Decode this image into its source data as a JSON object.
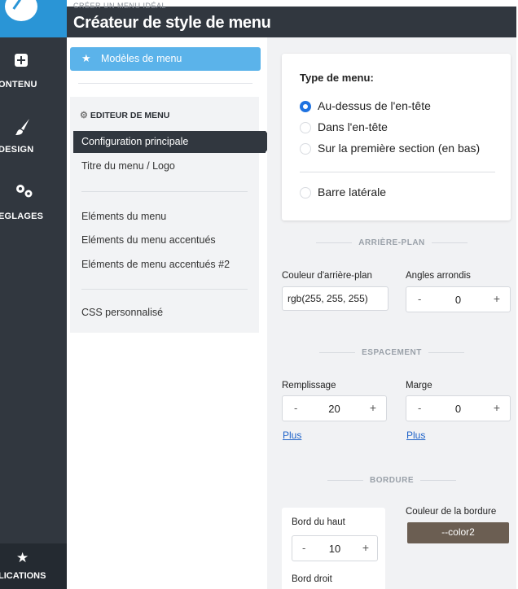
{
  "app": {
    "kicker": "CRÉER UN MENU IDÉAL",
    "title": "Créateur de style de menu"
  },
  "rail": {
    "items": [
      {
        "label": "ONTENU",
        "icon": "plus-square-icon"
      },
      {
        "label": "DESIGN",
        "icon": "brush-icon"
      },
      {
        "label": "EGLAGES",
        "icon": "gears-icon"
      },
      {
        "label": "LICATIONS",
        "icon": "star-icon"
      }
    ]
  },
  "middle": {
    "templates_button": "Modèles de menu",
    "editor_heading": "EDITEUR DE MENU",
    "items": [
      "Configuration principale",
      "Titre du menu / Logo",
      "Eléments du menu",
      "Eléments du menu accentués",
      "Eléments de menu accentués #2",
      "CSS personnalisé"
    ]
  },
  "type_card": {
    "heading": "Type de menu:",
    "options": [
      {
        "label": "Au-dessus de l'en-tête",
        "selected": true
      },
      {
        "label": "Dans l'en-tête",
        "selected": false
      },
      {
        "label": "Sur la première section (en bas)",
        "selected": false
      },
      {
        "label": "Barre latérale",
        "selected": false
      }
    ]
  },
  "background": {
    "section_label": "ARRIÈRE-PLAN",
    "color_label": "Couleur d'arrière-plan",
    "color_value": "rgb(255, 255, 255)",
    "radius_label": "Angles arrondis",
    "radius_value": "0"
  },
  "spacing": {
    "section_label": "ESPACEMENT",
    "padding_label": "Remplissage",
    "padding_value": "20",
    "margin_label": "Marge",
    "margin_value": "0",
    "more_link": "Plus"
  },
  "border": {
    "section_label": "BORDURE",
    "top_label": "Bord du haut",
    "top_value": "10",
    "right_label": "Bord droit",
    "color_label": "Couleur de la bordure",
    "color_value": "--color2"
  },
  "stepper": {
    "minus": "-",
    "plus": "+"
  },
  "colors": {
    "rail_bg": "#31373f",
    "accent_blue": "#2a95d6",
    "templates_button": "#5bb3ea",
    "radio_selected": "#1f72e0",
    "border_swatch": "#6b5e52"
  }
}
